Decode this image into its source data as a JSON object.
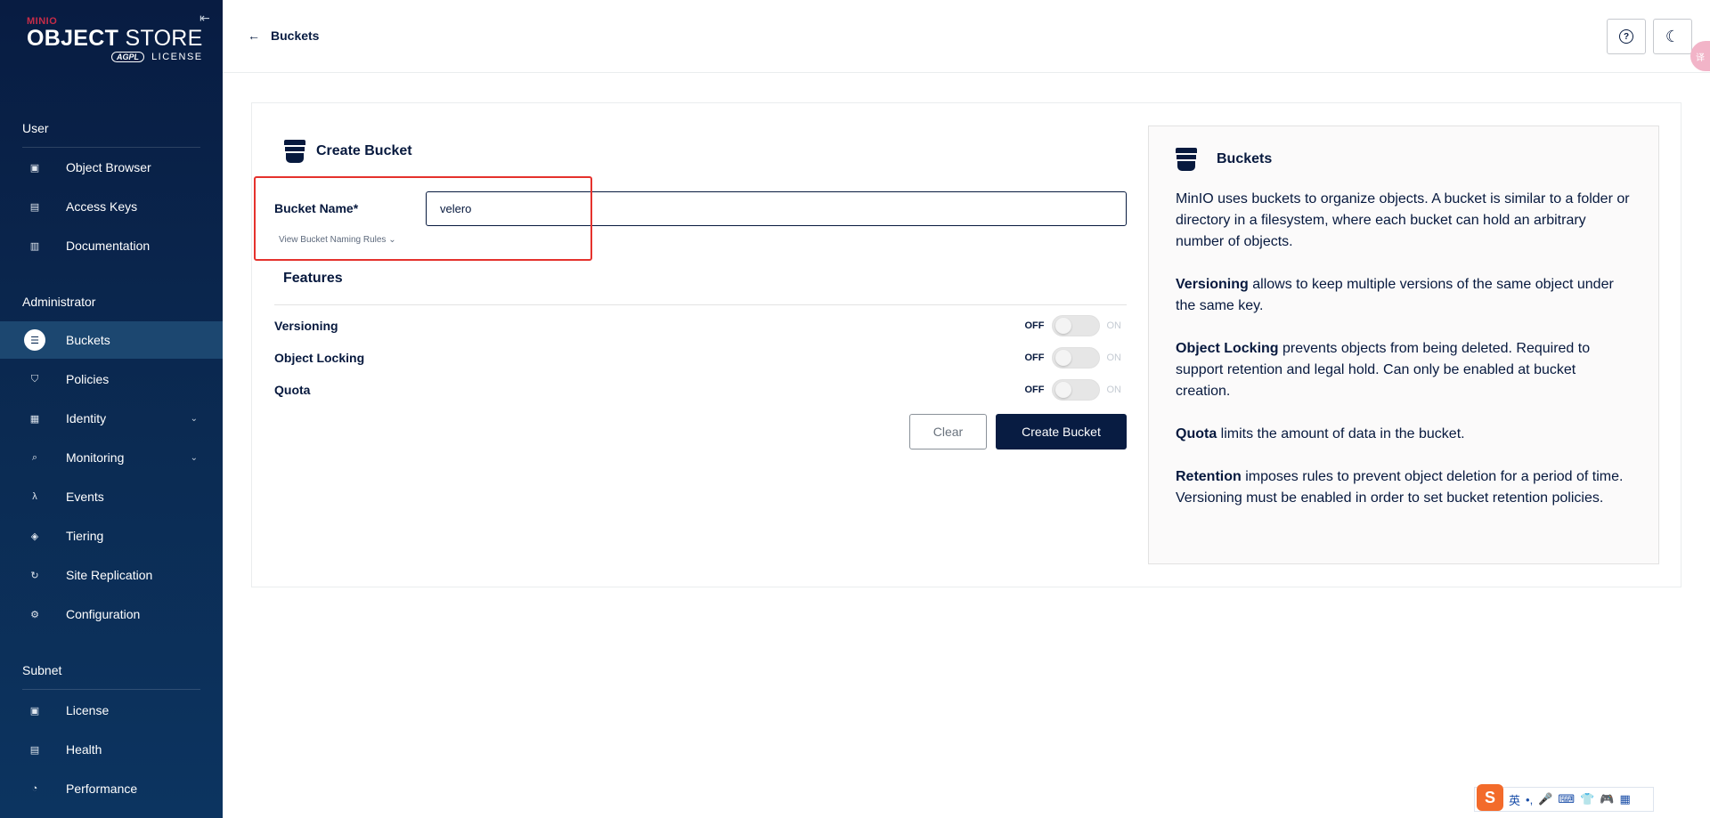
{
  "sidebar": {
    "logo": {
      "brand": "MINIO",
      "product_bold": "OBJECT",
      "product_light": "STORE",
      "license_badge": "AGPL",
      "license_text": "LICENSE"
    },
    "collapse_icon": "⇤",
    "sections": {
      "user": "User",
      "administrator": "Administrator",
      "subnet": "Subnet"
    },
    "items": [
      {
        "label": "Object Browser",
        "icon": "object-browser-icon",
        "glyph": "▣"
      },
      {
        "label": "Access Keys",
        "icon": "access-keys-icon",
        "glyph": "▤"
      },
      {
        "label": "Documentation",
        "icon": "documentation-icon",
        "glyph": "▥"
      },
      {
        "label": "Buckets",
        "icon": "bucket-icon",
        "glyph": "☰"
      },
      {
        "label": "Policies",
        "icon": "shield-icon",
        "glyph": "⛉"
      },
      {
        "label": "Identity",
        "icon": "id-card-icon",
        "glyph": "▦"
      },
      {
        "label": "Monitoring",
        "icon": "magnifier-icon",
        "glyph": "⌕"
      },
      {
        "label": "Events",
        "icon": "lambda-icon",
        "glyph": "λ"
      },
      {
        "label": "Tiering",
        "icon": "layers-icon",
        "glyph": "◈"
      },
      {
        "label": "Site Replication",
        "icon": "sync-icon",
        "glyph": "↻"
      },
      {
        "label": "Configuration",
        "icon": "gear-icon",
        "glyph": "⚙"
      },
      {
        "label": "License",
        "icon": "license-icon",
        "glyph": "▣"
      },
      {
        "label": "Health",
        "icon": "health-icon",
        "glyph": "▤"
      },
      {
        "label": "Performance",
        "icon": "gauge-icon",
        "glyph": "◔"
      }
    ],
    "chevron": "⌄"
  },
  "topbar": {
    "back_arrow": "←",
    "back_label": "Buckets",
    "help_glyph": "?",
    "theme_glyph": "☾",
    "translate_glyph": "译"
  },
  "form": {
    "title": "Create Bucket",
    "bucket_name_label": "Bucket Name*",
    "bucket_name_value": "velero",
    "naming_rules": "View Bucket Naming Rules ⌄",
    "features_title": "Features",
    "features": [
      {
        "label": "Versioning",
        "off": "OFF",
        "on": "ON"
      },
      {
        "label": "Object Locking",
        "off": "OFF",
        "on": "ON"
      },
      {
        "label": "Quota",
        "off": "OFF",
        "on": "ON"
      }
    ],
    "clear_label": "Clear",
    "create_label": "Create Bucket"
  },
  "help": {
    "title": "Buckets",
    "intro": "MinIO uses buckets to organize objects. A bucket is similar to a folder or directory in a filesystem, where each bucket can hold an arbitrary number of objects.",
    "versioning_term": "Versioning",
    "versioning_text": " allows to keep multiple versions of the same object under the same key.",
    "locking_term": "Object Locking",
    "locking_text": " prevents objects from being deleted. Required to support retention and legal hold. Can only be enabled at bucket creation.",
    "quota_term": "Quota",
    "quota_text": " limits the amount of data in the bucket.",
    "retention_term": "Retention",
    "retention_text": " imposes rules to prevent object deletion for a period of time. Versioning must be enabled in order to set bucket retention policies."
  },
  "ime": {
    "logo": "S",
    "lang": "英",
    "punct": "•,",
    "mic": "🎤",
    "keyboard": "⌨",
    "skin": "👕",
    "game": "🎮",
    "grid": "▦"
  },
  "colors": {
    "sidebar_bg": "#081c42",
    "active_item_bg": "#1c4770",
    "primary_button": "#081c42",
    "highlight_box": "#e5322d",
    "brand_red": "#c72c48"
  }
}
